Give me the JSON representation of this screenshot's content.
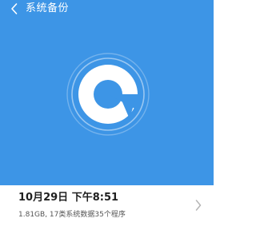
{
  "colors": {
    "hero_background": "#3d95e6",
    "foreground": "#ffffff",
    "chevron": "#b5b5b5"
  },
  "header": {
    "back_icon": "back-arrow-icon",
    "title": "系统备份"
  },
  "hero": {
    "logo_icon": "backup-logo-icon"
  },
  "backup": {
    "date": "10月29日 下午8:51",
    "summary": "1.81GB, 17类系统数据35个程序",
    "chevron_icon": "chevron-right-icon"
  }
}
